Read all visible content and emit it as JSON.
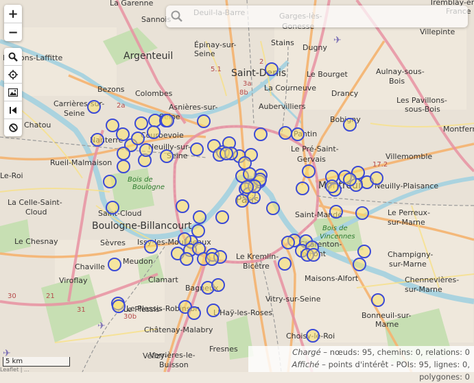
{
  "map": {
    "places": [
      {
        "name": "La Garenne",
        "cls": "small"
      },
      {
        "name": "Sannois",
        "cls": "small"
      },
      {
        "name": "Deuil-la-Barre",
        "cls": "small"
      },
      {
        "name": "Garges-lès-",
        "cls": "small"
      },
      {
        "name": "Gonesse",
        "cls": "small"
      },
      {
        "name": "Tremblay-en-",
        "cls": "small"
      },
      {
        "name": "France",
        "cls": "small"
      },
      {
        "name": "Villepinte",
        "cls": "small"
      },
      {
        "name": "Argenteuil",
        "cls": "big"
      },
      {
        "name": "Épinay-sur-",
        "cls": "small"
      },
      {
        "name": "Seine",
        "cls": "small"
      },
      {
        "name": "Stains",
        "cls": "small"
      },
      {
        "name": "Dugny",
        "cls": "small"
      },
      {
        "name": "Maisons-Laffitte",
        "cls": "small"
      },
      {
        "name": "Saint-Denis",
        "cls": "big"
      },
      {
        "name": "Le Bourget",
        "cls": "small"
      },
      {
        "name": "Aulnay-sous-",
        "cls": "small"
      },
      {
        "name": "Bois",
        "cls": "small"
      },
      {
        "name": "Bezons",
        "cls": "small"
      },
      {
        "name": "Colombes",
        "cls": "small"
      },
      {
        "name": "La Courneuve",
        "cls": "small"
      },
      {
        "name": "Drancy",
        "cls": "small"
      },
      {
        "name": "Carrières-sur-",
        "cls": "small"
      },
      {
        "name": "Seine",
        "cls": "small"
      },
      {
        "name": "Asnières-sur-",
        "cls": "small"
      },
      {
        "name": "Seine",
        "cls": "small"
      },
      {
        "name": "Aubervilliers",
        "cls": "small"
      },
      {
        "name": "Bobigny",
        "cls": "small"
      },
      {
        "name": "Les Pavillons-",
        "cls": "small"
      },
      {
        "name": "sous-Bois",
        "cls": "small"
      },
      {
        "name": "Chatou",
        "cls": "small"
      },
      {
        "name": "Courbevoie",
        "cls": "small"
      },
      {
        "name": "Pantin",
        "cls": "small"
      },
      {
        "name": "Montferm",
        "cls": "small"
      },
      {
        "name": "Nanterre",
        "cls": "small"
      },
      {
        "name": "Neuilly-sur-",
        "cls": "small"
      },
      {
        "name": "Seine",
        "cls": "small"
      },
      {
        "name": "Le Pré-Saint-",
        "cls": "small"
      },
      {
        "name": "Gervais",
        "cls": "small"
      },
      {
        "name": "Villemomble",
        "cls": "small"
      },
      {
        "name": "Rueil-Malmaison",
        "cls": "small"
      },
      {
        "name": "Le-Roi",
        "cls": "small"
      },
      {
        "name": "Montreuil",
        "cls": "big"
      },
      {
        "name": "Neuilly-Plaisance",
        "cls": "small"
      },
      {
        "name": "Paris",
        "cls": "big"
      },
      {
        "name": "La Celle-Saint-",
        "cls": "small"
      },
      {
        "name": "Cloud",
        "cls": "small"
      },
      {
        "name": "Saint-Cloud",
        "cls": "small"
      },
      {
        "name": "Saint-Mandé",
        "cls": "small"
      },
      {
        "name": "Le Perreux-",
        "cls": "small"
      },
      {
        "name": "sur-Marne",
        "cls": "small"
      },
      {
        "name": "Boulogne-Billancourt",
        "cls": "big"
      },
      {
        "name": "Le Chesnay",
        "cls": "small"
      },
      {
        "name": "Sèvres",
        "cls": "small"
      },
      {
        "name": "Issy-les-Moulineaux",
        "cls": "small"
      },
      {
        "name": "Charenton-",
        "cls": "small"
      },
      {
        "name": "le-Pont",
        "cls": "small"
      },
      {
        "name": "Champigny-",
        "cls": "small"
      },
      {
        "name": "sur-Marne",
        "cls": "small"
      },
      {
        "name": "Chaville",
        "cls": "small"
      },
      {
        "name": "Meudon",
        "cls": "small"
      },
      {
        "name": "Le Kremlin-",
        "cls": "small"
      },
      {
        "name": "Bicêtre",
        "cls": "small"
      },
      {
        "name": "Le Plessis-",
        "cls": "small"
      },
      {
        "name": "Viroflay",
        "cls": "small"
      },
      {
        "name": "Clamart",
        "cls": "small"
      },
      {
        "name": "Maisons-Alfort",
        "cls": "small"
      },
      {
        "name": "Chennevières-",
        "cls": "small"
      },
      {
        "name": "sur-Marne",
        "cls": "small"
      },
      {
        "name": "Bagneux",
        "cls": "small"
      },
      {
        "name": "Vitry-sur-Seine",
        "cls": "small"
      },
      {
        "name": "Le Plessis-Robinson",
        "cls": "small"
      },
      {
        "name": "L'Haÿ-les-Roses",
        "cls": "small"
      },
      {
        "name": "Bonneuil-sur-",
        "cls": "small"
      },
      {
        "name": "Marne",
        "cls": "small"
      },
      {
        "name": "Châtenay-Malabry",
        "cls": "small"
      },
      {
        "name": "Choisy-le-Roi",
        "cls": "small"
      },
      {
        "name": "Fresnes",
        "cls": "small"
      },
      {
        "name": "Vélizy-",
        "cls": "small"
      },
      {
        "name": "Verrières-le-",
        "cls": "small"
      },
      {
        "name": "Buisson",
        "cls": "small"
      }
    ],
    "parks": [
      "Bois de",
      "Boulogne",
      "Bois de",
      "Vincennes"
    ],
    "road_labels": [
      "2a",
      "8b",
      "5.1",
      "2",
      "3a",
      "17.2",
      "30",
      "30b",
      "31",
      "21",
      "2"
    ]
  },
  "controls": {
    "zoom_in": "+",
    "zoom_out": "−"
  },
  "search": {
    "value": ""
  },
  "stats": {
    "loaded_label": "Chargé",
    "loaded_text": " – nœuds: 95, chemins: 0, relations: 0",
    "shown_label": "Affiché",
    "shown_text": " – points d'intérêt - POIs: 95, lignes: 0, polygones: 0"
  },
  "scale": {
    "label": "5 km"
  },
  "attribution": "Leaflet | ..."
}
